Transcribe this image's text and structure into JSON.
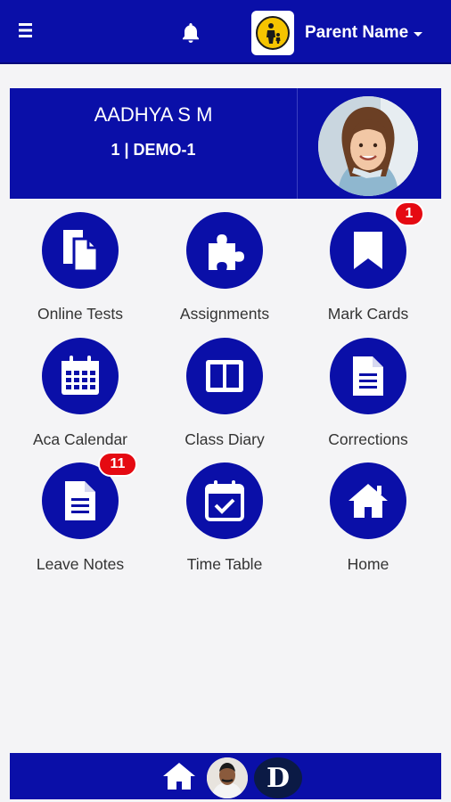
{
  "header": {
    "menu_icon": "hamburger-menu-icon",
    "bell_icon": "bell-icon",
    "logo_icon": "school-logo-icon",
    "parent_name": "Parent Name",
    "colors": {
      "bar": "#0a0fa8",
      "logo_bg": "#f5c400"
    }
  },
  "profile": {
    "name": "AADHYA S M",
    "class_section": "1 | DEMO-1",
    "photo_icon": "student-photo"
  },
  "tiles": [
    {
      "label": "Online Tests",
      "icon": "document-copy-icon",
      "badge": ""
    },
    {
      "label": "Assignments",
      "icon": "puzzle-icon",
      "badge": ""
    },
    {
      "label": "Mark Cards",
      "icon": "bookmark-icon",
      "badge": "1"
    },
    {
      "label": "Aca Calendar",
      "icon": "calendar-icon",
      "badge": ""
    },
    {
      "label": "Class Diary",
      "icon": "book-columns-icon",
      "badge": ""
    },
    {
      "label": "Corrections",
      "icon": "file-text-icon",
      "badge": ""
    },
    {
      "label": "Leave Notes",
      "icon": "file-lines-icon",
      "badge": "11"
    },
    {
      "label": "Time Table",
      "icon": "calendar-check-icon",
      "badge": ""
    },
    {
      "label": "Home",
      "icon": "home-icon",
      "badge": ""
    }
  ],
  "footer": {
    "home_icon": "home-icon",
    "avatar_icon": "user-avatar",
    "brand_letter": "D"
  }
}
